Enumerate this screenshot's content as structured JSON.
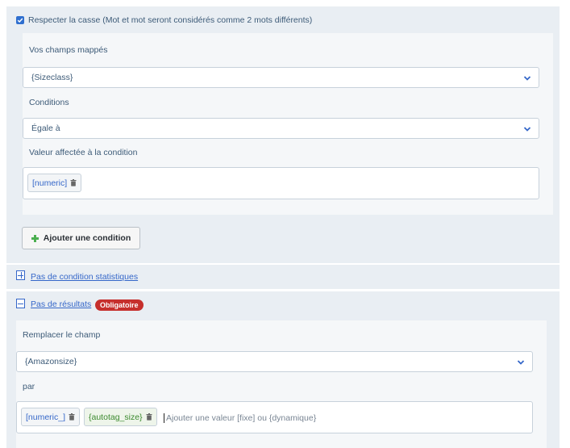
{
  "case_sensitive": {
    "checked": true,
    "label": "Respecter la casse (Mot et mot seront considérés comme 2 mots différents)"
  },
  "condition": {
    "mapped_label": "Vos champs mappés",
    "mapped_value": "{Sizeclass}",
    "conditions_label": "Conditions",
    "conditions_value": "Égale à",
    "assigned_label": "Valeur affectée à la condition",
    "assigned_tags": [
      "[numeric]"
    ]
  },
  "add_condition_label": "Ajouter une condition",
  "stats_link": "Pas de condition statistiques",
  "results": {
    "link": "Pas de résultats",
    "badge": "Obligatoire",
    "replace_label": "Remplacer le champ",
    "replace_value": "{Amazonsize}",
    "by_label": "par",
    "by_tags": [
      "[numeric_]",
      "{autotag_size}"
    ],
    "by_placeholder": "Ajouter une valeur [fixe] ou {dynamique}"
  },
  "colors": {
    "accent": "#3567c9",
    "badge": "#c62f2c",
    "add_icon": "#4caf50"
  },
  "icons": [
    "checkbox-checked-icon",
    "chevron-down-icon",
    "trash-icon",
    "plus-icon",
    "expand-icon",
    "collapse-icon"
  ]
}
